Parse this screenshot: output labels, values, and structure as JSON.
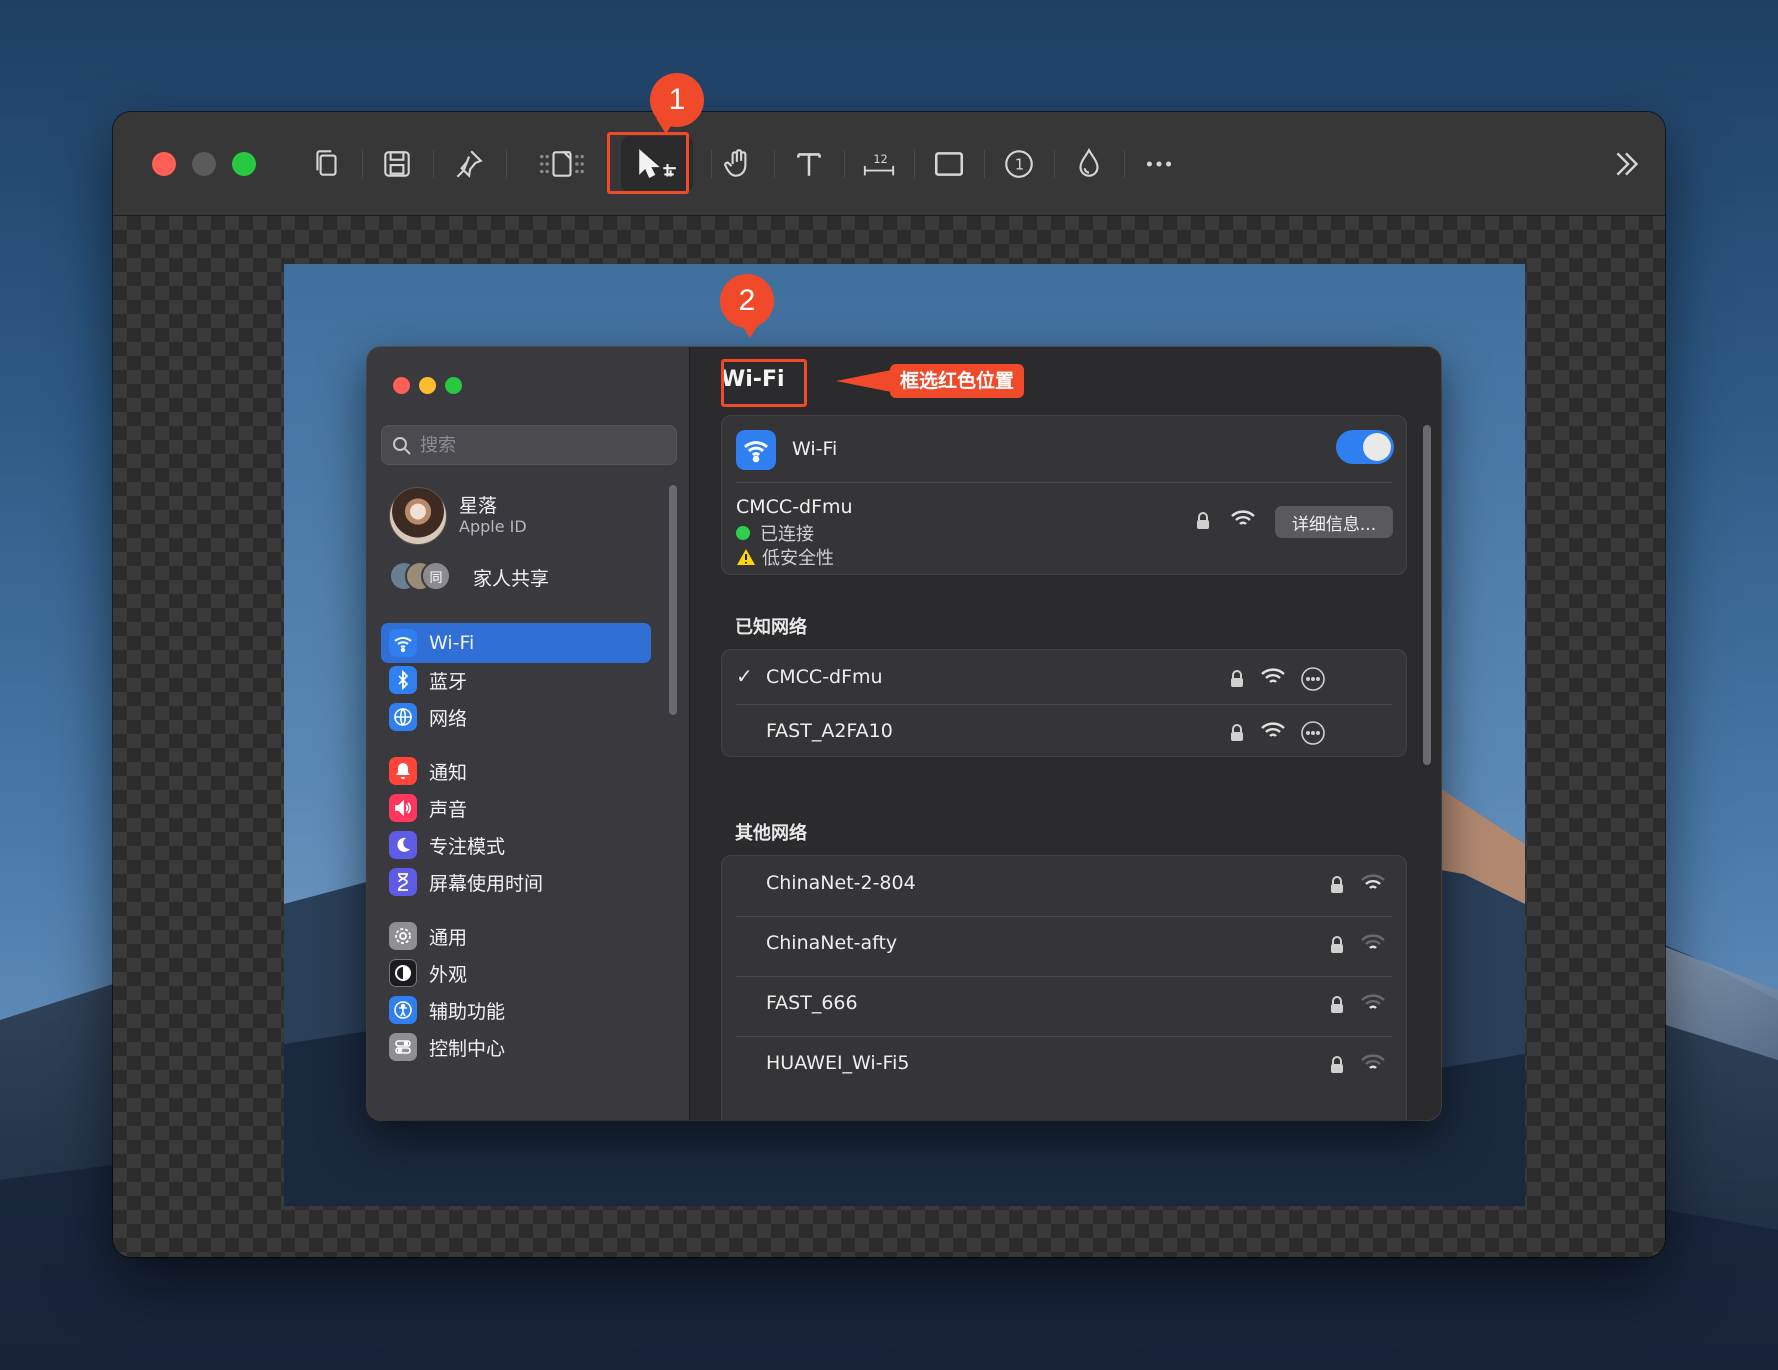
{
  "toolbar": {
    "traffic_lights": [
      "#ff5f57",
      "#5b5b5b",
      "#28c840"
    ],
    "tools": [
      {
        "name": "copy-icon"
      },
      {
        "name": "save-icon"
      },
      {
        "name": "pin-icon"
      },
      {
        "name": "frame-icon"
      },
      {
        "name": "select-crop-icon",
        "active": true
      },
      {
        "name": "hand-icon"
      },
      {
        "name": "text-icon"
      },
      {
        "name": "ruler-icon",
        "label": "12"
      },
      {
        "name": "rectangle-icon"
      },
      {
        "name": "counter-icon",
        "label": "1"
      },
      {
        "name": "drop-icon"
      },
      {
        "name": "more-icon"
      }
    ],
    "expand_icon": "chevron-double-right-icon"
  },
  "annotations": {
    "badge1": "1",
    "badge2": "2",
    "callout": "框选红色位置",
    "accent": "#f04a2b"
  },
  "settings": {
    "search_placeholder": "搜索",
    "account": {
      "name": "星落",
      "sub": "Apple ID"
    },
    "family": {
      "label": "家人共享",
      "avatar_text": "同"
    },
    "nav": [
      {
        "label": "Wi-Fi",
        "icon": "wifi-icon",
        "color": "#2f7ff0",
        "selected": true
      },
      {
        "label": "蓝牙",
        "icon": "bluetooth-icon",
        "color": "#2f7ff0"
      },
      {
        "label": "网络",
        "icon": "globe-icon",
        "color": "#2f7ff0"
      },
      {
        "label": "通知",
        "icon": "bell-icon",
        "color": "#ff453a"
      },
      {
        "label": "声音",
        "icon": "speaker-icon",
        "color": "#ff375f"
      },
      {
        "label": "专注模式",
        "icon": "moon-icon",
        "color": "#5e5ce6"
      },
      {
        "label": "屏幕使用时间",
        "icon": "hourglass-icon",
        "color": "#5e5ce6"
      },
      {
        "label": "通用",
        "icon": "gear-icon",
        "color": "#8e8e93"
      },
      {
        "label": "外观",
        "icon": "appearance-icon",
        "color": "#1c1c1e"
      },
      {
        "label": "辅助功能",
        "icon": "accessibility-icon",
        "color": "#2f7ff0"
      },
      {
        "label": "控制中心",
        "icon": "control-center-icon",
        "color": "#8e8e93"
      }
    ],
    "main": {
      "title": "Wi-Fi",
      "wifi_label": "Wi-Fi",
      "wifi_on": true,
      "current": {
        "ssid": "CMCC-dFmu",
        "status": "已连接",
        "warning": "低安全性",
        "details_button": "详细信息..."
      },
      "known_title": "已知网络",
      "known": [
        {
          "ssid": "CMCC-dFmu",
          "checked": true
        },
        {
          "ssid": "FAST_A2FA10",
          "checked": false
        }
      ],
      "other_title": "其他网络",
      "other": [
        {
          "ssid": "ChinaNet-2-804"
        },
        {
          "ssid": "ChinaNet-afty"
        },
        {
          "ssid": "FAST_666"
        },
        {
          "ssid": "HUAWEI_Wi-Fi5"
        }
      ]
    }
  }
}
